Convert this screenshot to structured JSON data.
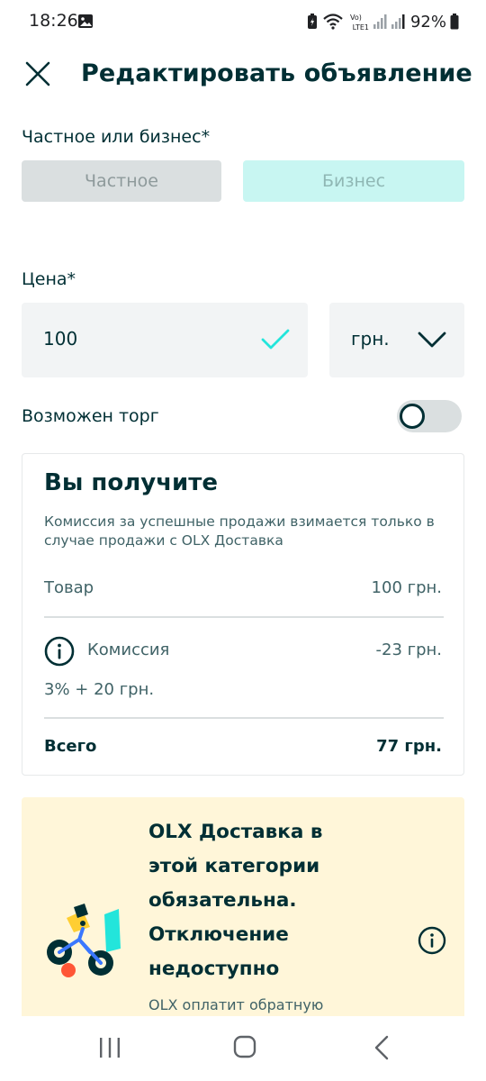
{
  "status_bar": {
    "time": "18:26",
    "battery_percent": "92%",
    "network_label": "LTE1"
  },
  "header": {
    "title": "Редактировать объявление"
  },
  "seller_type": {
    "label": "Частное или бизнес*",
    "options": [
      "Частное",
      "Бизнес"
    ]
  },
  "price": {
    "label": "Цена*",
    "value": "100",
    "currency": "грн."
  },
  "negotiable": {
    "label": "Возможен торг",
    "enabled": false
  },
  "payout_card": {
    "title": "Вы получите",
    "description": "Комиссия за успешные продажи взимается только в случае продажи с OLX Доставка",
    "item_label": "Товар",
    "item_value": "100 грн.",
    "commission_label": "Комиссия",
    "commission_value": "-23 грн.",
    "commission_formula": "3% + 20 грн.",
    "total_label": "Всего",
    "total_value": "77 грн."
  },
  "delivery_card": {
    "title": "OLX Доставка в этой категории обязательна. Отключение недоступно",
    "note": "OLX оплатит обратную"
  },
  "colors": {
    "primary_text": "#002f34",
    "accent_teal": "#23e5db",
    "business_bg": "#c8f6f2",
    "delivery_bg": "#fff6d9",
    "input_bg": "#f2f4f5"
  },
  "icons": {
    "close": "close-icon",
    "check": "check-icon",
    "chevron": "chevron-down-icon",
    "info": "info-icon"
  }
}
